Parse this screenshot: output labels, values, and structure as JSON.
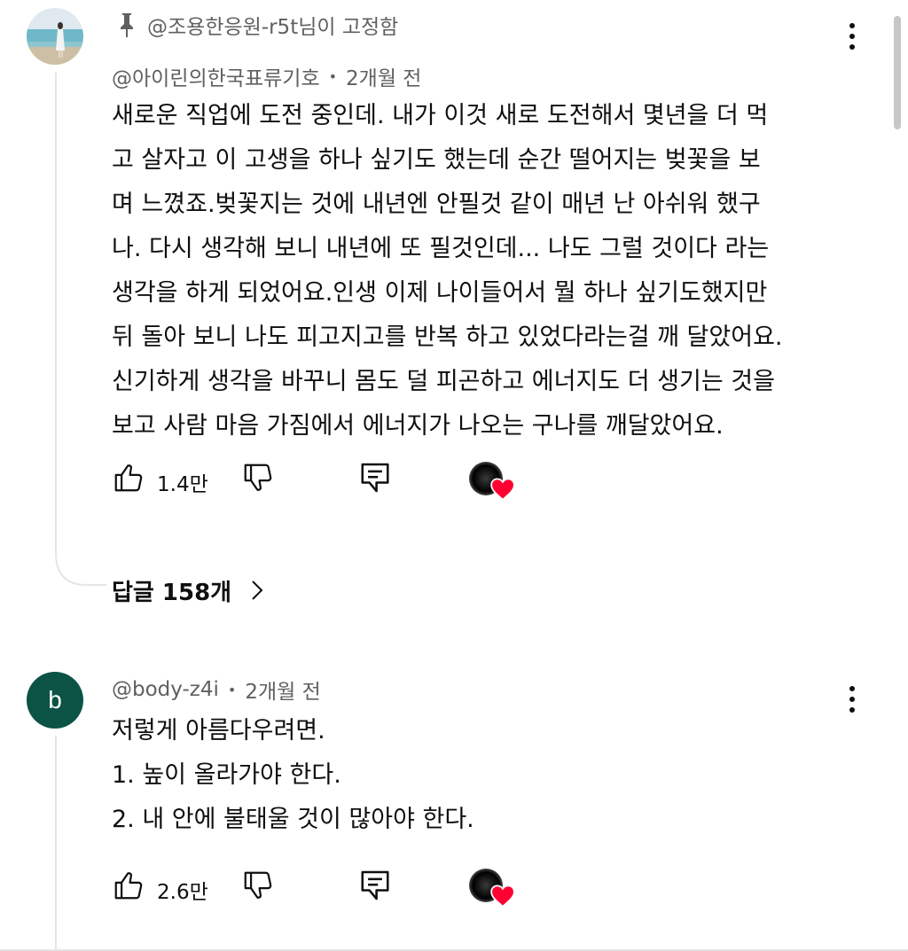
{
  "comments": [
    {
      "pinned_text": "@조용한응원-r5t님이 고정함",
      "author": "@아이린의한국표류기호",
      "time": "2개월 전",
      "lines": [
        "새로운 직업에 도전 중인데. 내가 이것 새로 도전해서  몇년을 더 먹",
        "고 살자고  이 고생을 하나 싶기도 했는데 순간 떨어지는 벚꽃을 보",
        "며 느꼈죠.벚꽃지는 것에 내년엔 안필것 같이   매년 난 아쉬워  했구",
        "나. 다시 생각해 보니 내년에 또 필것인데... 나도 그럴 것이다 라는",
        "생각을 하게 되었어요.인생 이제 나이들어서 뭘 하나 싶기도했지만",
        "뒤 돌아 보니 나도 피고지고를 반복 하고 있었다라는걸 깨 달았어요.",
        "신기하게 생각을 바꾸니 몸도 덜 피곤하고 에너지도 더 생기는 것을",
        "보고 사람 마음 가짐에서 에너지가 나오는 구나를 깨달았어요."
      ],
      "likes": "1.4만",
      "replies_label": "답글 158개"
    },
    {
      "avatar_letter": "b",
      "author": "@body-z4i",
      "time": "2개월 전",
      "lines": [
        "저렇게 아름다우려면.",
        "1. 높이 올라가야 한다.",
        "2. 내 안에 불태울 것이 많아야 한다."
      ],
      "likes": "2.6만"
    }
  ],
  "separator": "•",
  "icons": {
    "pin": "pin-icon",
    "like": "thumbs-up-icon",
    "dislike": "thumbs-down-icon",
    "reply": "reply-icon",
    "heart": "heart-icon",
    "more": "more-vert-icon",
    "chevron": "chevron-right-icon"
  },
  "colors": {
    "heart": "#ff0033",
    "avatar_b_bg": "#0b5345",
    "meta_text": "#606060"
  }
}
